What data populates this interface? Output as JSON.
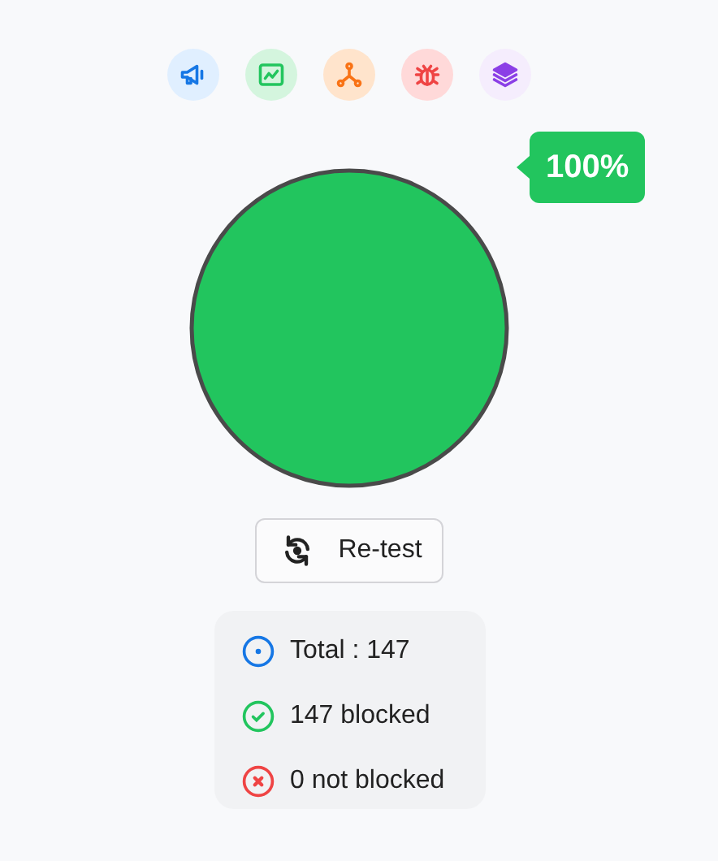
{
  "toolbar": [
    {
      "kind": "megaphone"
    },
    {
      "kind": "chart"
    },
    {
      "kind": "network"
    },
    {
      "kind": "bug"
    },
    {
      "kind": "layers"
    }
  ],
  "result": {
    "label": "100%"
  },
  "retest_button": "Re-test",
  "stats": [
    {
      "kind": "total",
      "text": "Total : 147"
    },
    {
      "kind": "blocked",
      "text": "147 blocked"
    },
    {
      "kind": "not_blocked",
      "text": "0 not blocked"
    }
  ]
}
